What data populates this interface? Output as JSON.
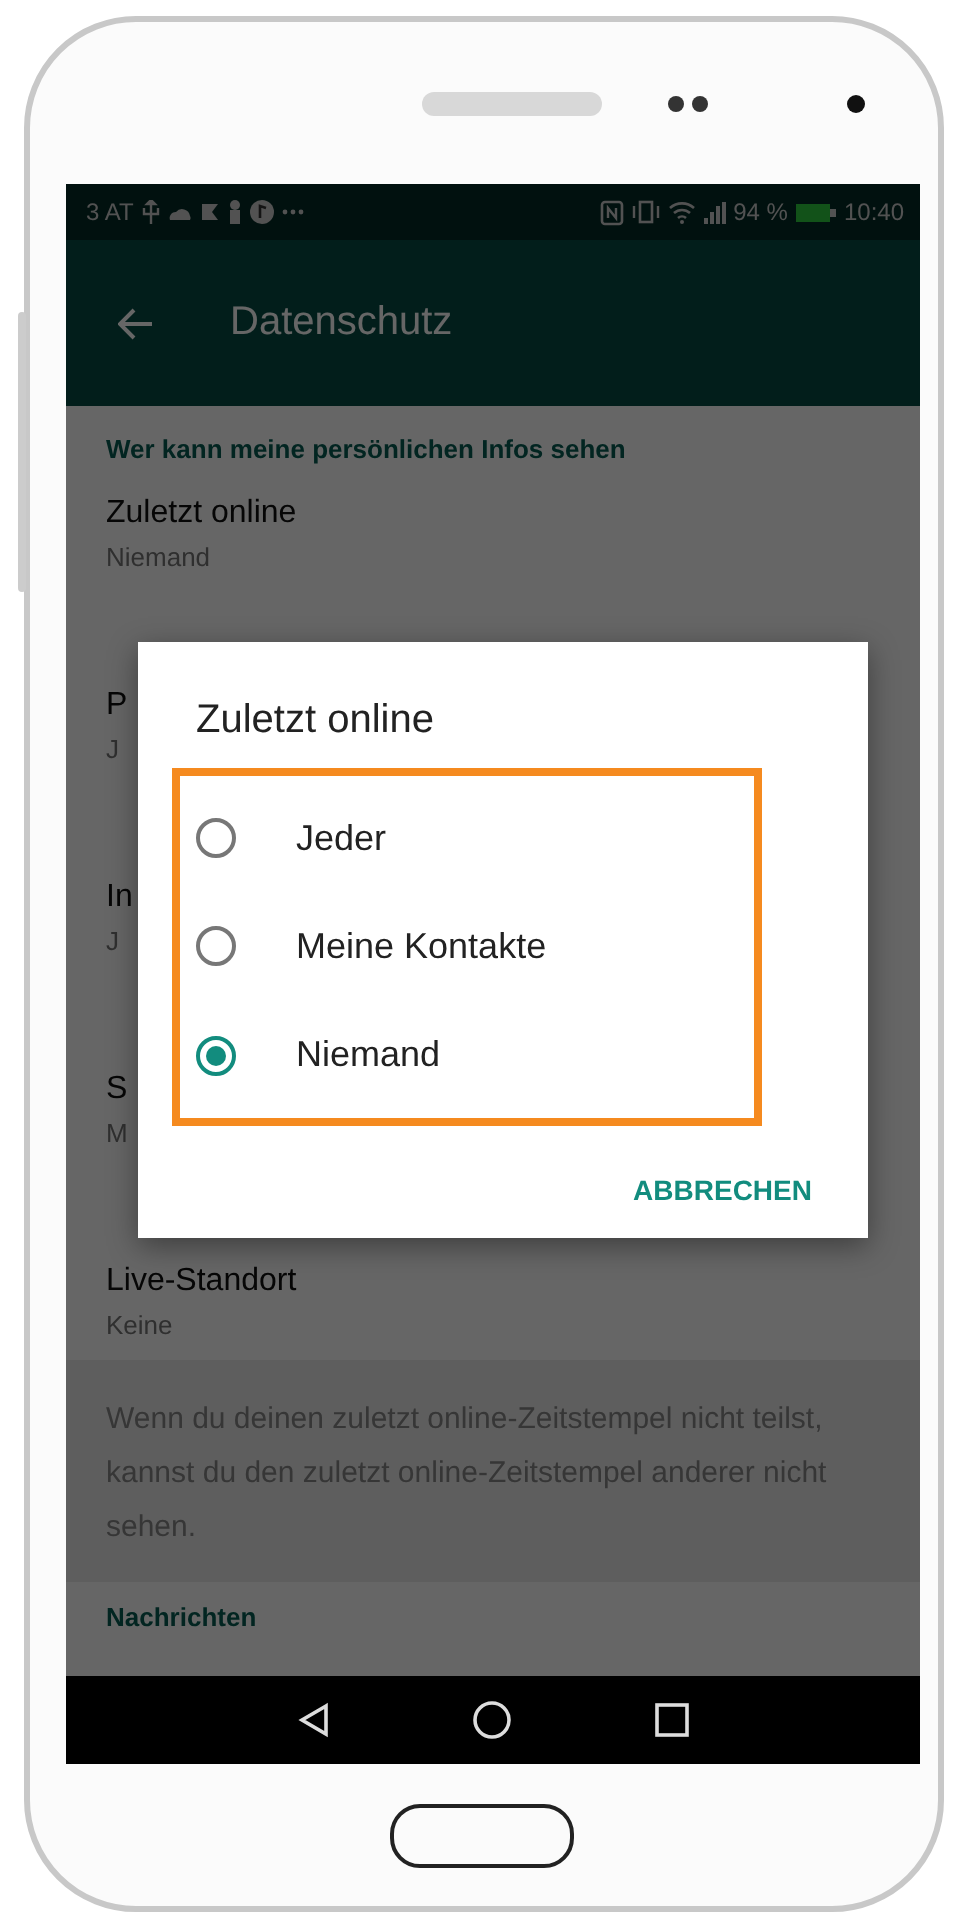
{
  "status_bar": {
    "carrier": "3 AT",
    "battery": "94 %",
    "time": "10:40"
  },
  "app_bar": {
    "title": "Datenschutz"
  },
  "section_header": "Wer kann meine persönlichen Infos sehen",
  "settings": [
    {
      "title": "Zuletzt online",
      "subtitle": "Niemand"
    },
    {
      "title": "P",
      "subtitle": "J"
    },
    {
      "title": "In",
      "subtitle": "J"
    },
    {
      "title": "S",
      "subtitle": "M"
    },
    {
      "title": "Live-Standort",
      "subtitle": "Keine"
    }
  ],
  "info_text": "Wenn du deinen zuletzt online-Zeitstempel nicht teilst, kannst du den zuletzt online-Zeitstempel anderer nicht sehen.",
  "next_section_header": "Nachrichten",
  "dialog": {
    "title": "Zuletzt online",
    "options": [
      {
        "label": "Jeder",
        "selected": false
      },
      {
        "label": "Meine Kontakte",
        "selected": false
      },
      {
        "label": "Niemand",
        "selected": true
      }
    ],
    "button": "ABBRECHEN"
  }
}
